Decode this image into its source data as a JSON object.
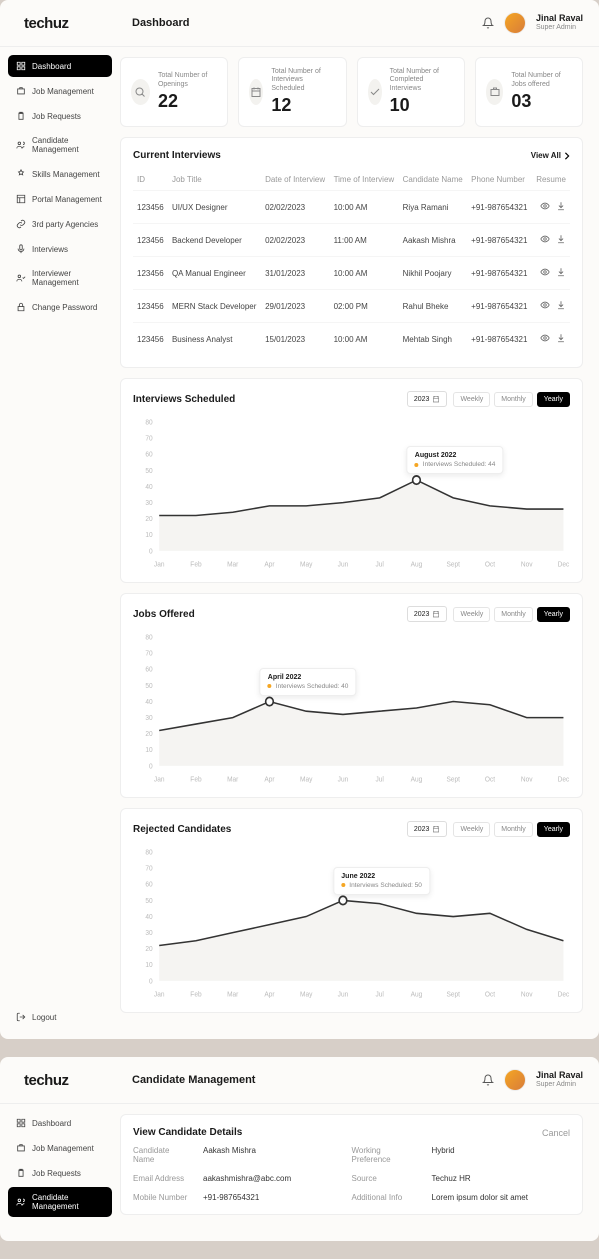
{
  "brand": "techuz",
  "user": {
    "name": "Jinal Raval",
    "role": "Super Admin"
  },
  "app1": {
    "title": "Dashboard",
    "sidebar": [
      {
        "label": "Dashboard",
        "icon": "grid",
        "active": true
      },
      {
        "label": "Job Management",
        "icon": "briefcase"
      },
      {
        "label": "Job Requests",
        "icon": "clipboard"
      },
      {
        "label": "Candidate Management",
        "icon": "users"
      },
      {
        "label": "Skills Management",
        "icon": "award"
      },
      {
        "label": "Portal Management",
        "icon": "layout"
      },
      {
        "label": "3rd party Agencies",
        "icon": "link"
      },
      {
        "label": "Interviews",
        "icon": "mic"
      },
      {
        "label": "Interviewer Management",
        "icon": "user-check"
      },
      {
        "label": "Change Password",
        "icon": "lock"
      }
    ],
    "logout": "Logout",
    "stats": [
      {
        "label": "Total Number of Openings",
        "value": "22",
        "icon": "search"
      },
      {
        "label": "Total Number of Interviews Scheduled",
        "value": "12",
        "icon": "calendar"
      },
      {
        "label": "Total Number of Completed Interviews",
        "value": "10",
        "icon": "check"
      },
      {
        "label": "Total Number of Jobs offered",
        "value": "03",
        "icon": "briefcase"
      }
    ],
    "interviews": {
      "title": "Current Interviews",
      "view_all": "View All",
      "columns": [
        "ID",
        "Job Title",
        "Date of Interview",
        "Time of Interview",
        "Candidate Name",
        "Phone Number",
        "Resume"
      ],
      "rows": [
        [
          "123456",
          "UI/UX Designer",
          "02/02/2023",
          "10:00 AM",
          "Riya Ramani",
          "+91-987654321"
        ],
        [
          "123456",
          "Backend Developer",
          "02/02/2023",
          "11:00 AM",
          "Aakash Mishra",
          "+91-987654321"
        ],
        [
          "123456",
          "QA Manual Engineer",
          "31/01/2023",
          "10:00 AM",
          "Nikhil Poojary",
          "+91-987654321"
        ],
        [
          "123456",
          "MERN Stack Developer",
          "29/01/2023",
          "02:00 PM",
          "Rahul Bheke",
          "+91-987654321"
        ],
        [
          "123456",
          "Business Analyst",
          "15/01/2023",
          "10:00 AM",
          "Mehtab Singh",
          "+91-987654321"
        ]
      ]
    },
    "charts": [
      {
        "title": "Interviews Scheduled",
        "year": "2023",
        "segments": [
          "Weekly",
          "Monthly",
          "Yearly"
        ],
        "active_segment": "Yearly",
        "tooltip": {
          "title": "August 2022",
          "metric": "Interviews Scheduled: 44"
        },
        "tooltip_index": 7
      },
      {
        "title": "Jobs Offered",
        "year": "2023",
        "segments": [
          "Weekly",
          "Monthly",
          "Yearly"
        ],
        "active_segment": "Yearly",
        "tooltip": {
          "title": "April 2022",
          "metric": "Interviews Scheduled: 40"
        },
        "tooltip_index": 3
      },
      {
        "title": "Rejected Candidates",
        "year": "2023",
        "segments": [
          "Weekly",
          "Monthly",
          "Yearly"
        ],
        "active_segment": "Yearly",
        "tooltip": {
          "title": "June 2022",
          "metric": "Interviews Scheduled: 50"
        },
        "tooltip_index": 5
      }
    ]
  },
  "app2": {
    "title": "Candidate Management",
    "sidebar": [
      {
        "label": "Dashboard",
        "icon": "grid"
      },
      {
        "label": "Job Management",
        "icon": "briefcase"
      },
      {
        "label": "Job Requests",
        "icon": "clipboard"
      },
      {
        "label": "Candidate Management",
        "icon": "users",
        "active": true
      }
    ],
    "details": {
      "title": "View Candidate Details",
      "cancel": "Cancel",
      "fields": [
        {
          "label": "Candidate Name",
          "value": "Aakash Mishra"
        },
        {
          "label": "Working Preference",
          "value": "Hybrid"
        },
        {
          "label": "Email Address",
          "value": "aakashmishra@abc.com"
        },
        {
          "label": "Source",
          "value": "Techuz HR"
        },
        {
          "label": "Mobile Number",
          "value": "+91-987654321"
        },
        {
          "label": "Additional Info",
          "value": "Lorem ipsum dolor sit amet"
        }
      ]
    }
  },
  "chart_data": [
    {
      "type": "line",
      "title": "Interviews Scheduled",
      "xlabel": "",
      "ylabel": "",
      "ylim": [
        0,
        80
      ],
      "categories": [
        "Jan",
        "Feb",
        "Mar",
        "Apr",
        "May",
        "Jun",
        "Jul",
        "Aug",
        "Sept",
        "Oct",
        "Nov",
        "Dec"
      ],
      "values": [
        22,
        22,
        24,
        28,
        28,
        30,
        33,
        44,
        33,
        28,
        26,
        26
      ]
    },
    {
      "type": "line",
      "title": "Jobs Offered",
      "xlabel": "",
      "ylabel": "",
      "ylim": [
        0,
        80
      ],
      "categories": [
        "Jan",
        "Feb",
        "Mar",
        "Apr",
        "May",
        "Jun",
        "Jul",
        "Aug",
        "Sept",
        "Oct",
        "Nov",
        "Dec"
      ],
      "values": [
        22,
        26,
        30,
        40,
        34,
        32,
        34,
        36,
        40,
        38,
        30,
        30
      ]
    },
    {
      "type": "line",
      "title": "Rejected Candidates",
      "xlabel": "",
      "ylabel": "",
      "ylim": [
        0,
        80
      ],
      "categories": [
        "Jan",
        "Feb",
        "Mar",
        "Apr",
        "May",
        "Jun",
        "Jul",
        "Aug",
        "Sept",
        "Oct",
        "Nov",
        "Dec"
      ],
      "values": [
        22,
        25,
        30,
        35,
        40,
        50,
        48,
        42,
        40,
        42,
        32,
        25
      ]
    }
  ]
}
